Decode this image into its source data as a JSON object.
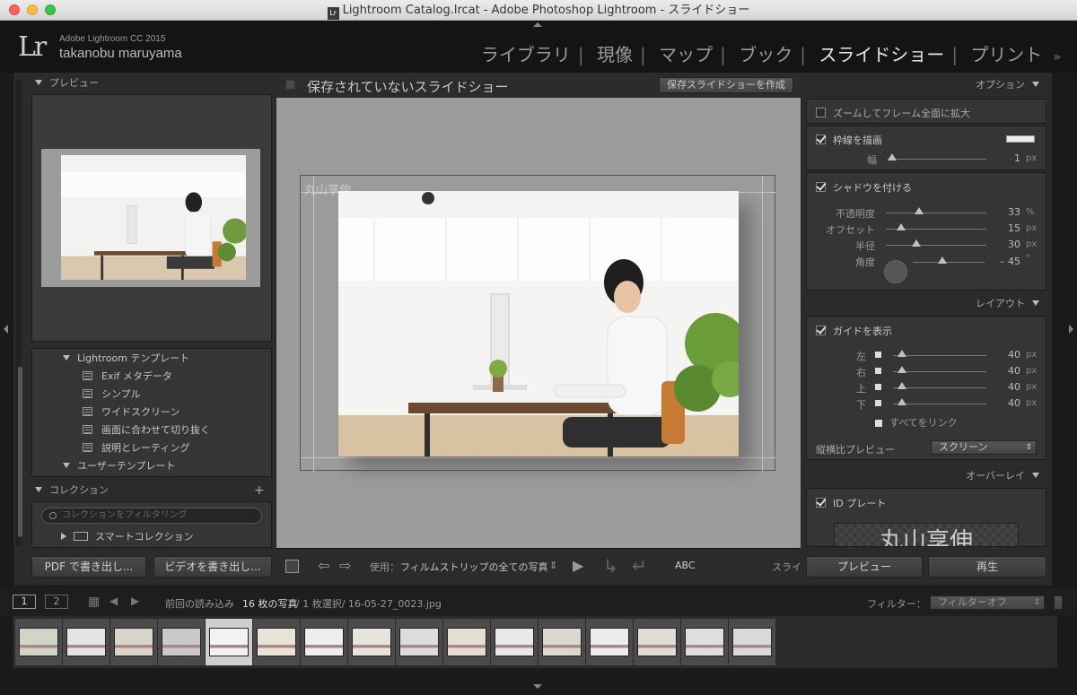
{
  "window": {
    "title": "Lightroom Catalog.lrcat - Adobe Photoshop Lightroom - スライドショー"
  },
  "identity": {
    "product": "Adobe Lightroom CC 2015",
    "user": "takanobu maruyama",
    "logo": "Lr"
  },
  "modules": [
    {
      "label": "ライブラリ"
    },
    {
      "label": "現像"
    },
    {
      "label": "マップ"
    },
    {
      "label": "ブック"
    },
    {
      "label": "スライドショー",
      "active": true
    },
    {
      "label": "プリント"
    }
  ],
  "left": {
    "preview_header": "プレビュー",
    "templates": {
      "lightroom_group": "Lightroom テンプレート",
      "items": [
        "Exif メタデータ",
        "シンプル",
        "ワイドスクリーン",
        "画面に合わせて切り抜く",
        "説明とレーティング"
      ],
      "user_group": "ユーザーテンプレート"
    },
    "collection_header": "コレクション",
    "collection_filter_placeholder": "コレクションをフィルタリング",
    "smart_collection": "スマートコレクション",
    "export_pdf": "PDF で書き出し...",
    "export_video": "ビデオを書き出し..."
  },
  "center": {
    "title": "保存されていないスライドショー",
    "save_button": "保存スライドショーを作成",
    "id_overlay": "丸山享伸",
    "toolbar": {
      "use_label": "使用：",
      "use_value": "フィルムストリップの全ての写真",
      "abc": "ABC",
      "slide_label": "スライ"
    }
  },
  "right": {
    "options_header": "オプション",
    "zoom_fill": "ズームしてフレーム全面に拡大",
    "stroke_border": "枠線を描画",
    "stroke_width_label": "幅",
    "stroke_width_value": "1",
    "stroke_width_unit": "px",
    "shadow": "シャドウを付ける",
    "shadow_sliders": [
      {
        "label": "不透明度",
        "value": "33",
        "unit": "%",
        "fraction": 0.33
      },
      {
        "label": "オフセット",
        "value": "15",
        "unit": "px",
        "fraction": 0.15
      },
      {
        "label": "半径",
        "value": "30",
        "unit": "px",
        "fraction": 0.3
      }
    ],
    "angle_label": "角度",
    "angle_value": "– 45",
    "angle_unit": "°",
    "layout_header": "レイアウト",
    "show_guides": "ガイドを表示",
    "guides": [
      {
        "label": "左",
        "value": "40",
        "unit": "px"
      },
      {
        "label": "右",
        "value": "40",
        "unit": "px"
      },
      {
        "label": "上",
        "value": "40",
        "unit": "px"
      },
      {
        "label": "下",
        "value": "40",
        "unit": "px"
      }
    ],
    "link_all": "すべてをリンク",
    "aspect_label": "縦横比プレビュー",
    "aspect_value": "スクリーン",
    "overlay_header": "オーバーレイ",
    "id_plate": "ID プレート",
    "id_plate_text": "丸山享伸",
    "preview_button": "プレビュー",
    "play_button": "再生"
  },
  "filmstrip": {
    "monitor1": "1",
    "monitor2": "2",
    "source_prefix": "前回の読み込み",
    "count": "16 枚の写真",
    "selection": "/ 1 枚選択/ 16-05-27_0023.jpg",
    "filter_label": "フィルター：",
    "filter_value": "フィルターオフ",
    "thumb_count": 16,
    "selected_index": 4
  }
}
